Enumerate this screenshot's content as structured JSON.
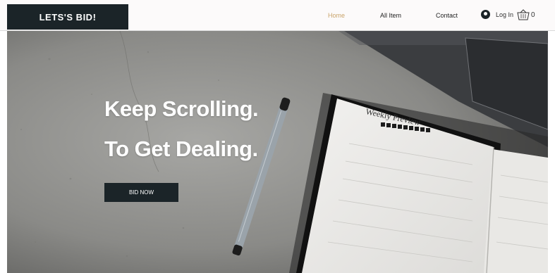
{
  "header": {
    "logo": "LETS'S BID!",
    "nav": [
      "Home",
      "All Item",
      "Contact"
    ],
    "login": "Log In",
    "cart_count": "0"
  },
  "hero": {
    "line1": "Keep Scrolling.",
    "line2": "To Get Dealing.",
    "button": "BID NOW",
    "notebook_title": "Weekly Preview"
  },
  "colors": {
    "dark": "#1b2428",
    "active_nav": "#c9a46a"
  }
}
